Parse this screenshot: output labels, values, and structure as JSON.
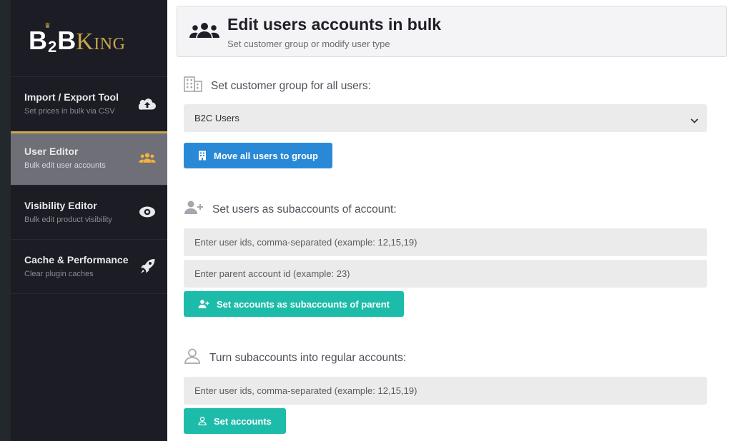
{
  "brand": {
    "logo_b2b": "B",
    "logo_two": "2",
    "logo_b_end": "B",
    "logo_king": "King"
  },
  "sidebar": {
    "items": [
      {
        "title": "Import / Export Tool",
        "subtitle": "Set prices in bulk via CSV",
        "icon": "cloud-upload-icon",
        "active": false
      },
      {
        "title": "User Editor",
        "subtitle": "Bulk edit user accounts",
        "icon": "users-icon",
        "active": true
      },
      {
        "title": "Visibility Editor",
        "subtitle": "Bulk edit product visibility",
        "icon": "eye-icon",
        "active": false
      },
      {
        "title": "Cache & Performance",
        "subtitle": "Clear plugin caches",
        "icon": "rocket-icon",
        "active": false
      }
    ]
  },
  "header": {
    "title": "Edit users accounts in bulk",
    "subtitle": "Set customer group or modify user type",
    "icon": "users-icon"
  },
  "group_section": {
    "title": "Set customer group for all users:",
    "icon": "building-icon",
    "selected_group": "B2C Users",
    "button_label": "Move all users to group"
  },
  "subaccount_section": {
    "title": "Set users as subaccounts of account:",
    "icon": "user-plus-icon",
    "user_ids_placeholder": "Enter user ids, comma-separated (example: 12,15,19)",
    "parent_id_placeholder": "Enter parent account id (example: 23)",
    "button_label": "Set accounts as subaccounts of parent"
  },
  "regular_section": {
    "title": "Turn subaccounts into regular accounts:",
    "icon": "user-icon",
    "user_ids_placeholder": "Enter user ids, comma-separated (example: 12,15,19)",
    "button_label": "Set accounts"
  },
  "colors": {
    "sidebar_bg": "#1c1c24",
    "active_item_bg": "#6f6f78",
    "accent_gold": "#c9a74a",
    "button_blue": "#2a89d6",
    "button_teal": "#1dbcaa"
  }
}
